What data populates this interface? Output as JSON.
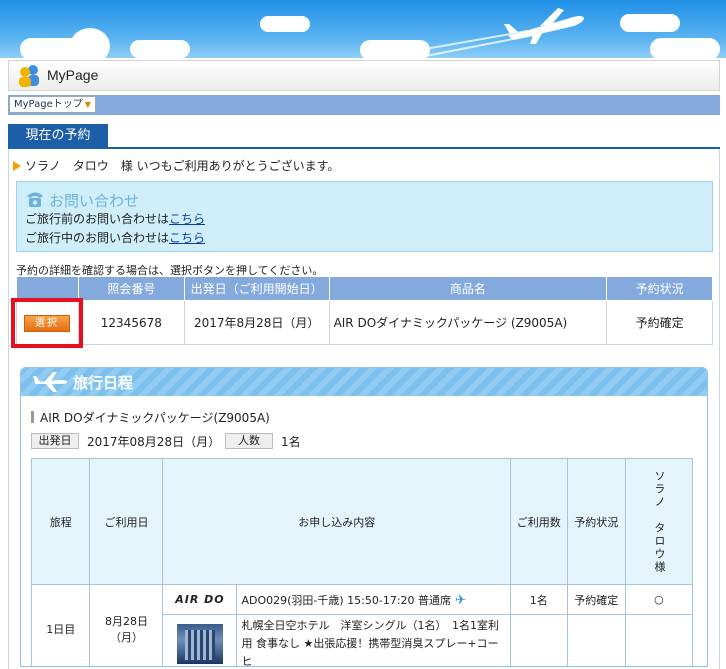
{
  "header": {
    "title": "MyPage"
  },
  "nav": {
    "dropdown_label": "MyPageトップ",
    "dropdown_arrow": "▼"
  },
  "tab": {
    "label": "現在の予約"
  },
  "greeting": "ソラノ　タロウ　様 いつもご利用ありがとうございます。",
  "contact": {
    "title": "お問い合わせ",
    "before_text": "ご旅行前のお問い合わせは",
    "before_link": "こちら",
    "during_text": "ご旅行中のお問い合わせは",
    "during_link": "こちら"
  },
  "instruction": "予約の詳細を確認する場合は、選択ボタンを押してください。",
  "reservation_table": {
    "headers": [
      "",
      "照会番号",
      "出発日（ご利用開始日）",
      "商品名",
      "予約状況"
    ],
    "row": {
      "select_label": "選択",
      "ref_no": "12345678",
      "date": "2017年8月28日（月）",
      "product": "AIR DOダイナミックパッケージ (Z9005A)",
      "status": "予約確定"
    }
  },
  "itinerary": {
    "title": "旅行日程",
    "package_name": "AIR DOダイナミックパッケージ(Z9005A)",
    "departure_label": "出発日",
    "departure_value": "2017年08月28日（月）",
    "people_label": "人数",
    "people_value": "1名",
    "headers": {
      "day": "旅程",
      "date": "ご利用日",
      "content": "お申し込み内容",
      "count": "ご利用数",
      "status": "予約状況",
      "traveler": "ソラノ　タロウ様"
    },
    "rows": [
      {
        "day": "1日目",
        "date": "8月28日（月）",
        "logo": "AIR DO",
        "content": "ADO029(羽田-千歳) 15:50-17:20 普通席",
        "count": "1名",
        "status": "予約確定",
        "traveler": "○"
      },
      {
        "content": "札幌全日空ホテル　洋室シングル（1名）　1名1室利用 食事なし ★出張応援！携帯型消臭スプレー+コーヒ"
      }
    ]
  },
  "colors": {
    "primary": "#1d5ea8",
    "table_header": "#84a9dc",
    "select_button": "#e66d12",
    "highlight_frame": "#e8101f",
    "contact_bg": "#cfeefa"
  }
}
